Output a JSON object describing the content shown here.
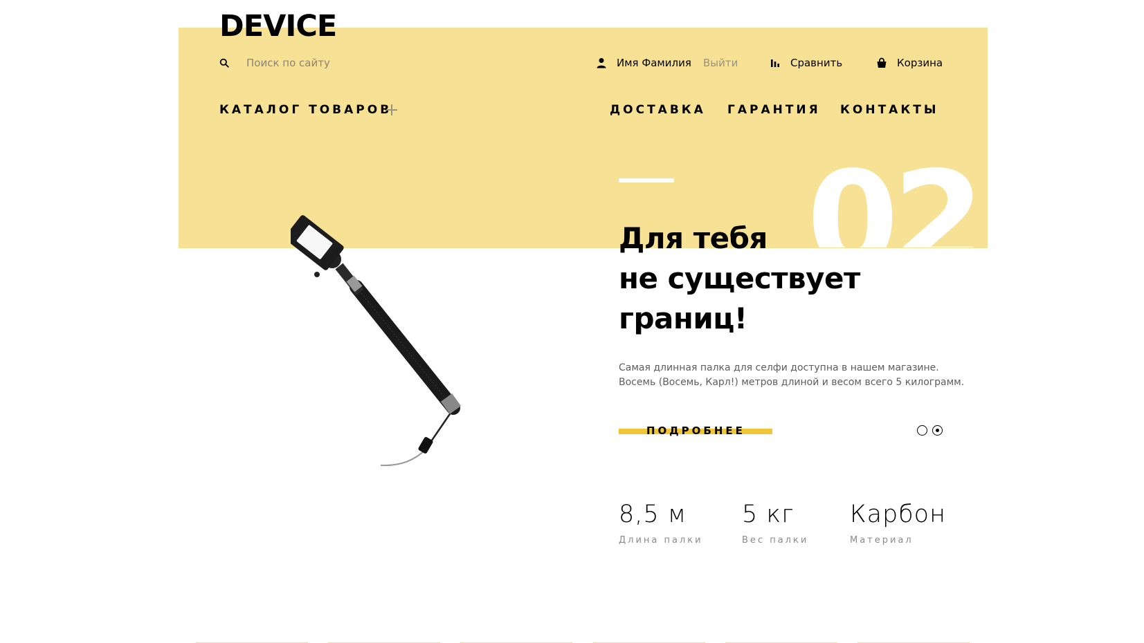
{
  "header": {
    "logo": "DEVICE",
    "search": {
      "placeholder": "Поиск по сайту"
    },
    "user": {
      "name": "Имя Фамилия",
      "logout": "Выйти"
    },
    "compare": "Сравнить",
    "cart": "Корзина"
  },
  "nav": {
    "catalog": "КАТАЛОГ ТОВАРОВ",
    "items": [
      "ДОСТАВКА",
      "ГАРАНТИЯ",
      "КОНТАКТЫ"
    ]
  },
  "slide": {
    "number": "02",
    "headline": [
      "Для тебя",
      "не существует",
      "границ!"
    ],
    "description": [
      "Самая длинная палка для селфи доступна в нашем магазине.",
      "Восемь (Восемь, Карл!) метров длиной и весом всего 5 килограмм."
    ],
    "more_button": "ПОДРОБНЕЕ",
    "active_dot_index": 1,
    "specs": [
      {
        "value": "8,5 м",
        "label": "Длина палки"
      },
      {
        "value": "5 кг",
        "label": "Вес палки"
      },
      {
        "value": "Карбон",
        "label": "Материал"
      }
    ]
  },
  "colors": {
    "hero_background": "#f7e195",
    "accent": "#f0c538",
    "text": "#000000",
    "muted": "#5d5d5d"
  },
  "icons": [
    "search-icon",
    "user-icon",
    "compare-icon",
    "cart-icon",
    "plus-icon"
  ]
}
